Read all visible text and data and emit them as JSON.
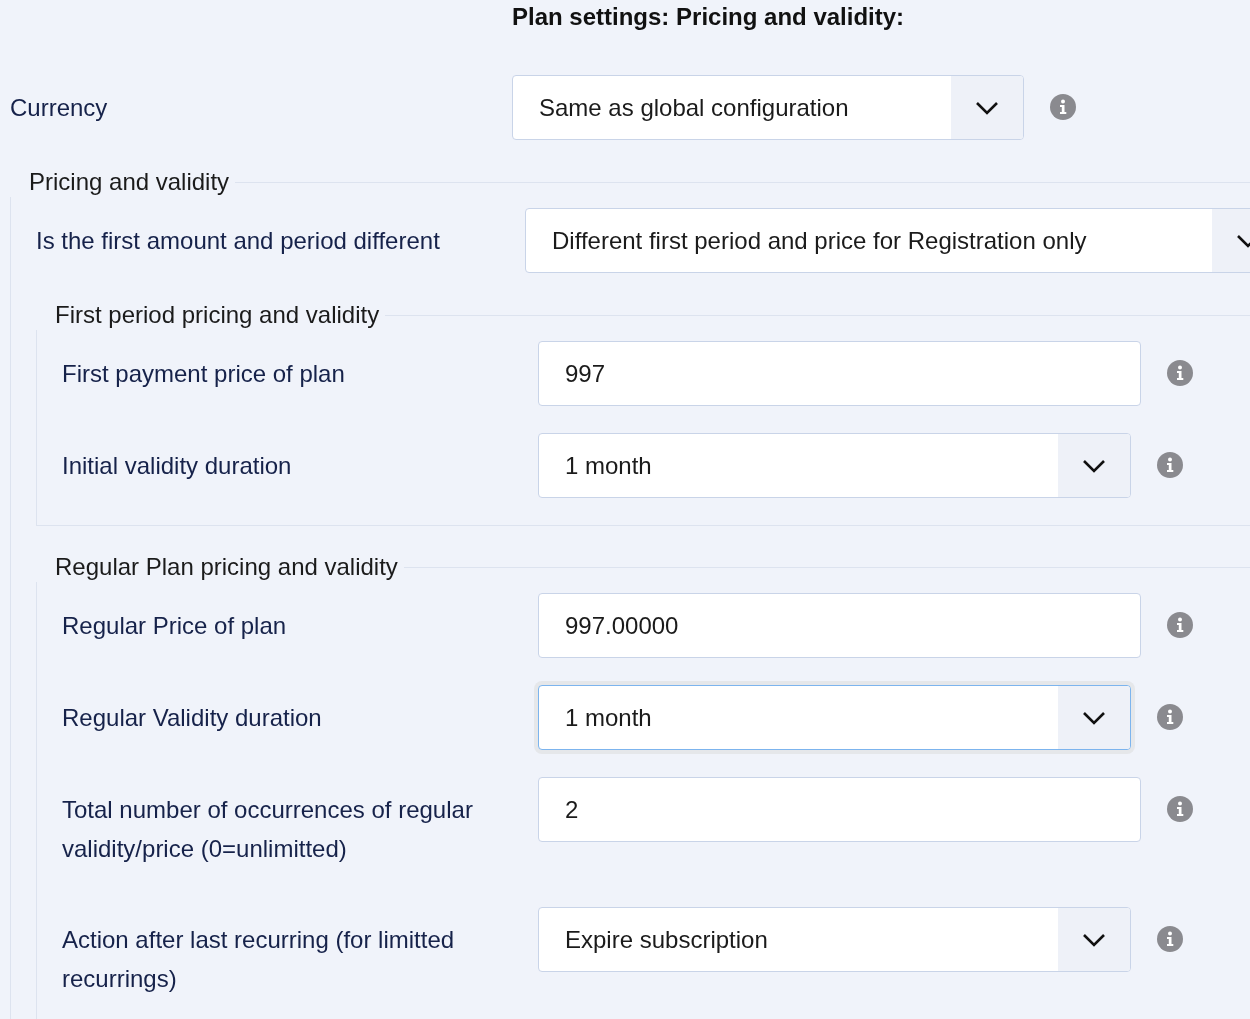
{
  "title": "Plan settings: Pricing and validity:",
  "fields": [
    {
      "kind": "select",
      "label": "Currency",
      "value": "Same as global configuration",
      "info": true,
      "focused": false
    }
  ],
  "groups": [
    {
      "legend": "Pricing and validity",
      "fields": [
        {
          "kind": "select",
          "label": "Is the first amount and period different",
          "value": "Different first period and price for Registration only",
          "info": false,
          "focused": false
        }
      ],
      "groups": [
        {
          "legend": "First period pricing and validity",
          "fields": [
            {
              "kind": "input",
              "label": "First payment price of plan",
              "value": "997",
              "info": true,
              "focused": false
            },
            {
              "kind": "select",
              "label": "Initial validity duration",
              "value": "1 month",
              "info": true,
              "focused": false
            }
          ]
        },
        {
          "legend": "Regular Plan pricing and validity",
          "fields": [
            {
              "kind": "input",
              "label": "Regular Price of plan",
              "value": "997.00000",
              "info": true,
              "focused": false
            },
            {
              "kind": "select",
              "label": "Regular Validity duration",
              "value": "1 month",
              "info": true,
              "focused": true
            },
            {
              "kind": "input",
              "label": "Total number of occurrences of regular validity/price (0=unlimitted)",
              "value": "2",
              "info": true,
              "focused": false
            },
            {
              "kind": "select",
              "label": "Action after last recurring (for limitted recurrings)",
              "value": "Expire subscription",
              "info": true,
              "focused": false
            }
          ]
        }
      ]
    }
  ]
}
